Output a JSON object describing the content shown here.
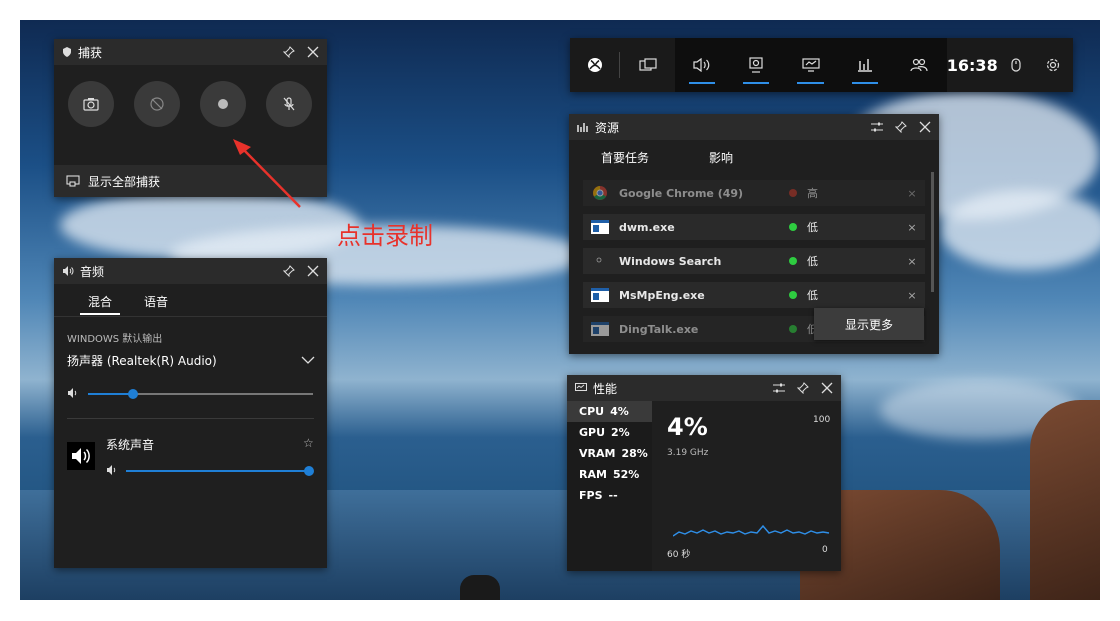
{
  "capture": {
    "title": "捕获",
    "footer_label": "显示全部捕获"
  },
  "annotation": {
    "text": "点击录制",
    "color": "#e8322b"
  },
  "audio": {
    "title": "音频",
    "tabs": [
      "混合",
      "语音"
    ],
    "output_label": "WINDOWS 默认输出",
    "device": "扬声器 (Realtek(R) Audio)",
    "master_volume": 0.2,
    "app_name": "系统声音",
    "app_volume": 1.0
  },
  "xbox_bar": {
    "time": "16:38"
  },
  "resources": {
    "title": "资源",
    "columns": [
      "首要任务",
      "影响"
    ],
    "rows": [
      {
        "name": "Google Chrome (49)",
        "impact": "高",
        "dot": "#c0392b",
        "icon": "chrome-icon"
      },
      {
        "name": "dwm.exe",
        "impact": "低",
        "dot": "#2ecc40",
        "icon": "window-icon"
      },
      {
        "name": "Windows Search",
        "impact": "低",
        "dot": "#2ecc40",
        "icon": "search-app-icon"
      },
      {
        "name": "MsMpEng.exe",
        "impact": "低",
        "dot": "#2ecc40",
        "icon": "window-icon"
      },
      {
        "name": "DingTalk.exe",
        "impact": "低",
        "dot": "#2ecc40",
        "icon": "window-icon"
      }
    ],
    "show_more": "显示更多"
  },
  "performance": {
    "title": "性能",
    "metrics": [
      {
        "label": "CPU",
        "value": "4%"
      },
      {
        "label": "GPU",
        "value": "2%"
      },
      {
        "label": "VRAM",
        "value": "28%"
      },
      {
        "label": "RAM",
        "value": "52%"
      },
      {
        "label": "FPS",
        "value": "--"
      }
    ],
    "big_value": "4%",
    "frequency": "3.19 GHz",
    "max_label": "100",
    "min_label": "0",
    "time_label": "60 秒"
  }
}
